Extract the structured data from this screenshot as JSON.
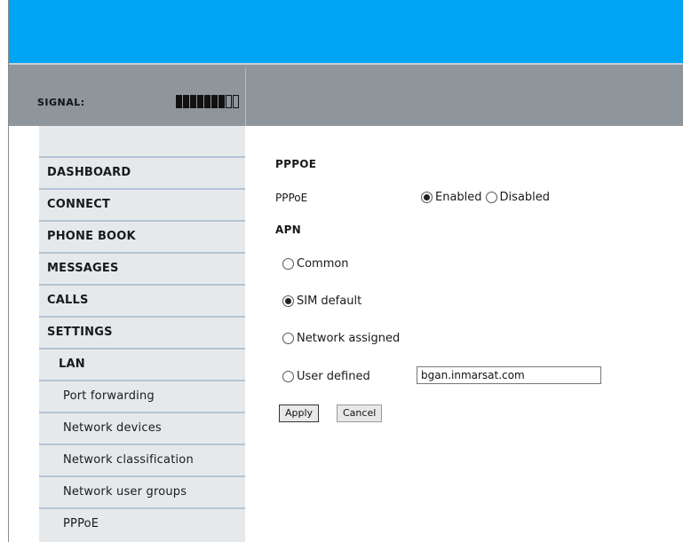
{
  "header": {
    "signal_label": "SIGNAL:",
    "signal_strength": {
      "filled": 7,
      "total": 9
    }
  },
  "sidebar": {
    "items": [
      {
        "label": "DASHBOARD"
      },
      {
        "label": "CONNECT"
      },
      {
        "label": "PHONE BOOK"
      },
      {
        "label": "MESSAGES"
      },
      {
        "label": "CALLS"
      },
      {
        "label": "SETTINGS"
      },
      {
        "label": "LAN"
      },
      {
        "label": "Port forwarding"
      },
      {
        "label": "Network devices"
      },
      {
        "label": "Network classification"
      },
      {
        "label": "Network user groups"
      },
      {
        "label": "PPPoE"
      }
    ]
  },
  "main": {
    "pppoe_heading": "PPPOE",
    "pppoe_label": "PPPoE",
    "pppoe_options": [
      {
        "label": "Enabled",
        "checked": true
      },
      {
        "label": "Disabled",
        "checked": false
      }
    ],
    "apn_heading": "APN",
    "apn_options": [
      {
        "label": "Common",
        "checked": false
      },
      {
        "label": "SIM default",
        "checked": true
      },
      {
        "label": "Network assigned",
        "checked": false
      },
      {
        "label": "User defined",
        "checked": false
      }
    ],
    "user_defined_value": "bgan.inmarsat.com",
    "apply_label": "Apply",
    "cancel_label": "Cancel"
  },
  "colors": {
    "topbar": "#00a4f4",
    "signalbar": "#8e969c",
    "sidebar_bg": "#e6e9ec",
    "sidebar_divider": "#b3c4d6"
  }
}
